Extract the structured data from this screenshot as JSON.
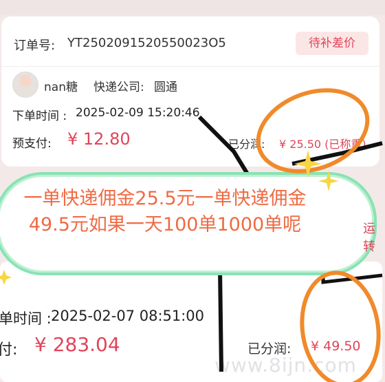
{
  "order1": {
    "order_label": "订单号:",
    "order_no": "YT2502091520550023O5",
    "status": "待补差价",
    "username": "nan糖",
    "courier_label": "快递公司:",
    "courier": "圆通",
    "order_time_label": "下单时间 :",
    "order_time": "2025-02-09 15:20:46",
    "prepay_label": "预支付:",
    "prepay": "¥ 12.80",
    "split_label": "已分润:",
    "split": "¥ 25.50 (已称重)"
  },
  "banner": {
    "text": "一单快递佣金25.5元一单快递佣金49.5元如果一天100单1000单呢",
    "right_partial": "运转"
  },
  "order2": {
    "partial_line": "...",
    "order_time_label": "单时间 :",
    "order_time": "2025-02-07 08:51:00",
    "prepay_label": "付:",
    "prepay": "¥ 283.04",
    "split_label": "已分润:",
    "split": "¥ 49.50",
    "watermark": "www.8ijn.com"
  },
  "colors": {
    "accent": "#e0445a",
    "banner_border": "#88e3b3",
    "banner_text": "#ef6a43",
    "circle": "#f08a2a"
  }
}
